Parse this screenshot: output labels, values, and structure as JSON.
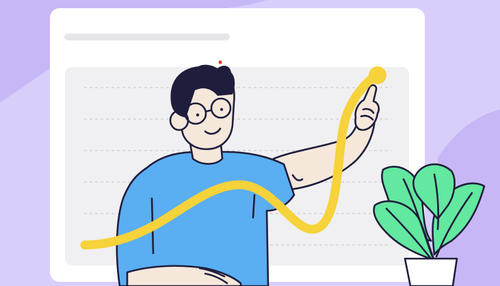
{
  "illustration": {
    "subject": "growth-chart-illustration",
    "colors": {
      "background": "#d9cef9",
      "background_blob": "#c8b7f6",
      "card": "#ffffff",
      "card_header_bar": "#e6e6ea",
      "chart_panel": "#f0f0f2",
      "grid_line": "#d3d3d8",
      "curve": "#f6d23b",
      "shirt": "#5aaef2",
      "skin": "#f6e7db",
      "hair": "#1e1e3c",
      "outline": "#1e1e3c",
      "plant_leaf": "#63e8a0",
      "pot": "#ffffff",
      "notification_dot": "#e0403a"
    },
    "icons": {
      "person": "person-pointing-icon",
      "plant": "potted-plant-icon",
      "curve": "trend-curve-icon"
    }
  }
}
